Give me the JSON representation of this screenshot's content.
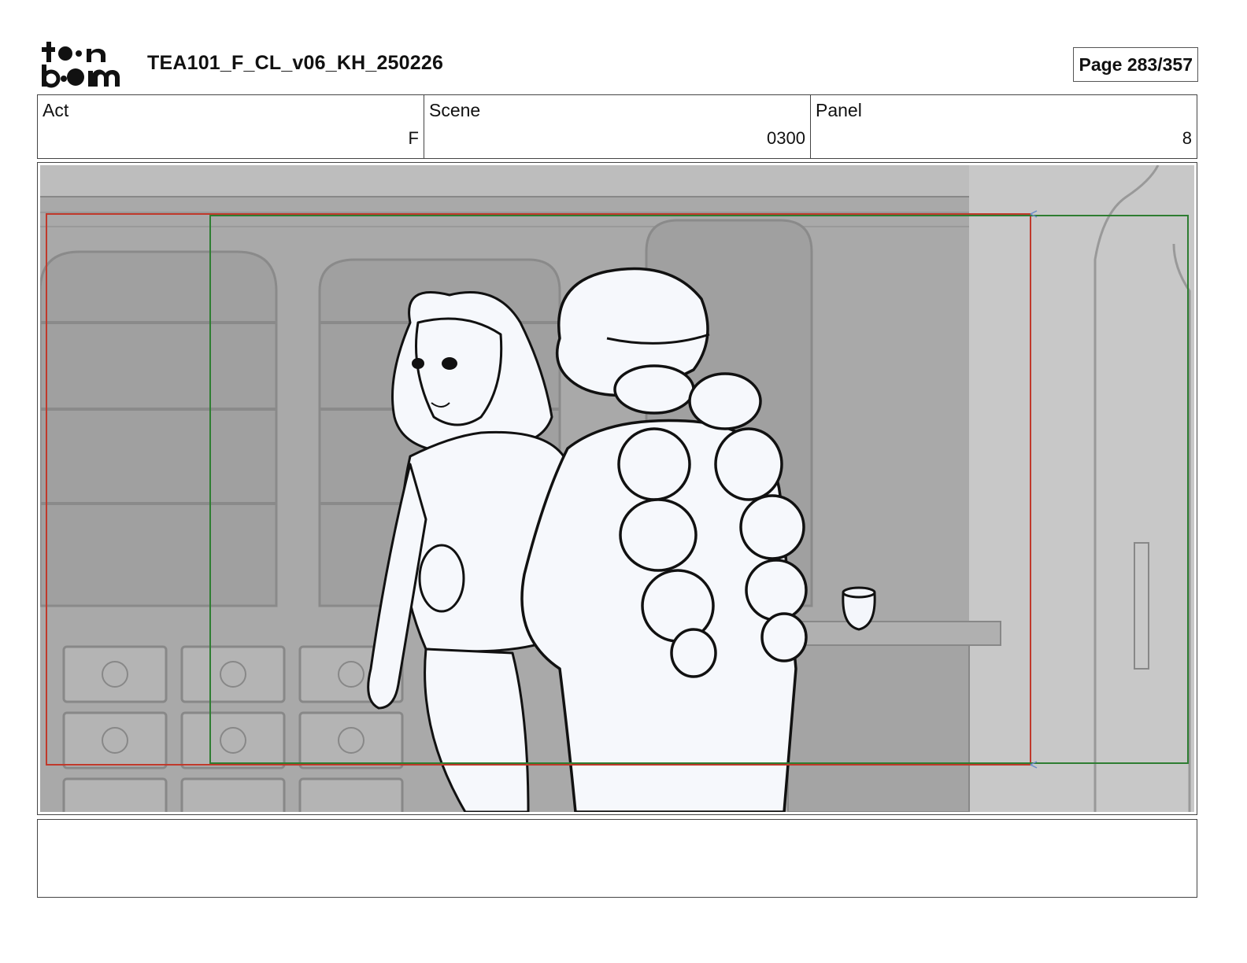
{
  "header": {
    "logo_text": "toon boom",
    "document_title": "TEA101_F_CL_v06_KH_250226",
    "page_label": "Page 283/357"
  },
  "info": {
    "act_label": "Act",
    "act_value": "F",
    "scene_label": "Scene",
    "scene_value": "0300",
    "panel_label": "Panel",
    "panel_value": "8"
  },
  "panel_image": {
    "description_icon": "storyboard-sketch",
    "safe_frame_color": "#c0392b",
    "camera_frame_color": "#2e7d32"
  },
  "notes": {
    "text": ""
  }
}
